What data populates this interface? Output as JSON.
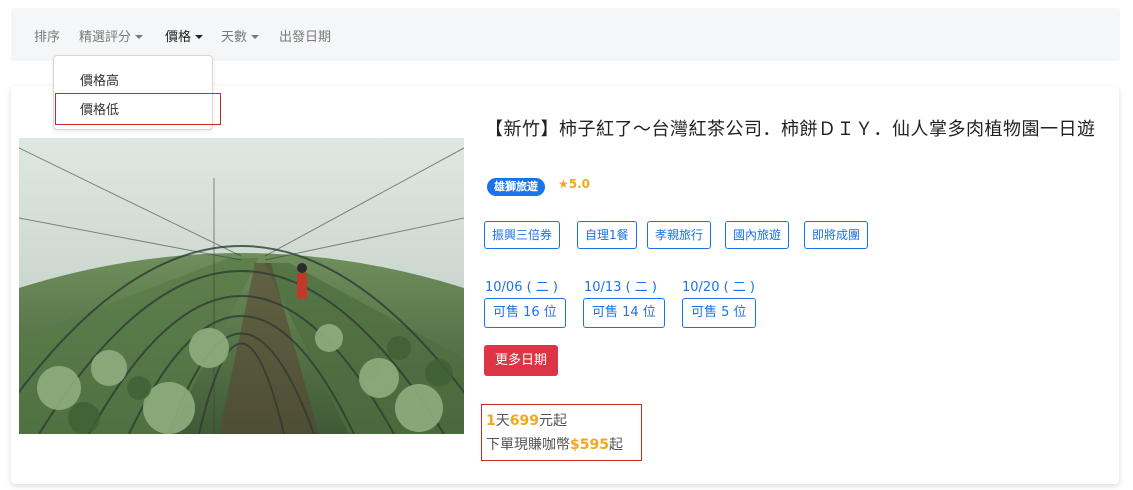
{
  "nav": {
    "sort": "排序",
    "rating": "精選評分",
    "price": "價格",
    "days": "天數",
    "departure": "出發日期"
  },
  "dropdown": {
    "items": [
      "價格高",
      "價格低"
    ]
  },
  "product": {
    "title": "【新竹】柿子紅了～台灣紅茶公司．柿餅ＤＩＹ．仙人掌多肉植物園一日遊",
    "brand": "雄獅旅遊",
    "rating": "5.0",
    "tags": [
      "振興三倍券",
      "自理1餐",
      "孝親旅行",
      "國內旅遊",
      "即將成團"
    ],
    "dates": [
      {
        "date": "10/06 ( 二 )",
        "seats": "可售 16 位"
      },
      {
        "date": "10/13 ( 二 )",
        "seats": "可售 14 位"
      },
      {
        "date": "10/20 ( 二 )",
        "seats": "可售 5 位"
      }
    ],
    "more_dates": "更多日期",
    "price": {
      "days": "1",
      "days_unit": "天",
      "amount": "699",
      "amount_suffix": "元起",
      "coin_prefix": "下單現賺咖幣",
      "coin_amount": "$595",
      "coin_suffix": "起"
    }
  },
  "colors": {
    "accent": "#1a73e8",
    "highlight": "#f0a81c",
    "danger": "#dc3545",
    "annotation": "#c62828"
  }
}
